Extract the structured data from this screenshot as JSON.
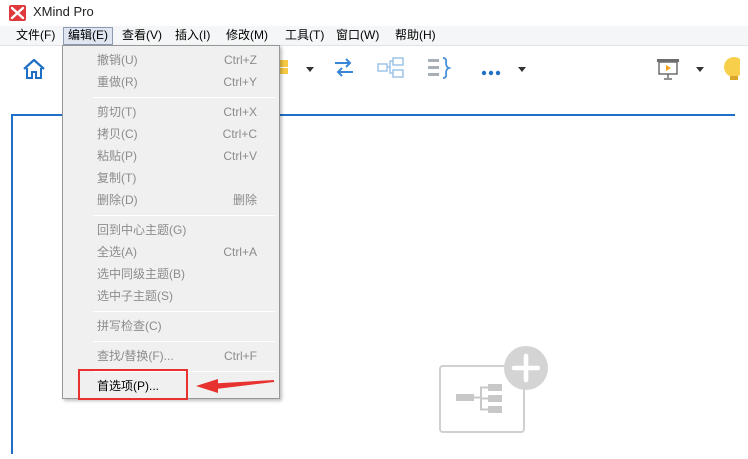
{
  "app": {
    "title": "XMind Pro"
  },
  "menubar": [
    {
      "label": "文件(F)"
    },
    {
      "label": "编辑(E)"
    },
    {
      "label": "查看(V)"
    },
    {
      "label": "插入(I)"
    },
    {
      "label": "修改(M)"
    },
    {
      "label": "工具(T)"
    },
    {
      "label": "窗口(W)"
    },
    {
      "label": "帮助(H)"
    }
  ],
  "edit_menu": {
    "items": [
      {
        "label": "撤销(U)",
        "shortcut": "Ctrl+Z",
        "enabled": false
      },
      {
        "label": "重做(R)",
        "shortcut": "Ctrl+Y",
        "enabled": false
      },
      {
        "label": "剪切(T)",
        "shortcut": "Ctrl+X",
        "enabled": false
      },
      {
        "label": "拷贝(C)",
        "shortcut": "Ctrl+C",
        "enabled": false
      },
      {
        "label": "粘贴(P)",
        "shortcut": "Ctrl+V",
        "enabled": false
      },
      {
        "label": "复制(T)",
        "shortcut": "",
        "enabled": false
      },
      {
        "label": "删除(D)",
        "shortcut": "删除",
        "enabled": false
      },
      {
        "label": "回到中心主题(G)",
        "shortcut": "",
        "enabled": false
      },
      {
        "label": "全选(A)",
        "shortcut": "Ctrl+A",
        "enabled": false
      },
      {
        "label": "选中同级主题(B)",
        "shortcut": "",
        "enabled": false
      },
      {
        "label": "选中子主题(S)",
        "shortcut": "",
        "enabled": false
      },
      {
        "label": "拼写检查(C)",
        "shortcut": "",
        "enabled": false
      },
      {
        "label": "查找/替换(F)...",
        "shortcut": "Ctrl+F",
        "enabled": false
      },
      {
        "label": "首选项(P)...",
        "shortcut": "",
        "enabled": true
      }
    ]
  },
  "toolbar": {
    "icons": [
      "home-icon",
      "color-swatch-icon",
      "relationship-icon",
      "summary-icon",
      "notes-icon",
      "more-icon",
      "presentation-icon",
      "idea-icon"
    ]
  },
  "annotation": {
    "highlight_color": "#e8322f",
    "accent_color": "#1e6fc8"
  }
}
